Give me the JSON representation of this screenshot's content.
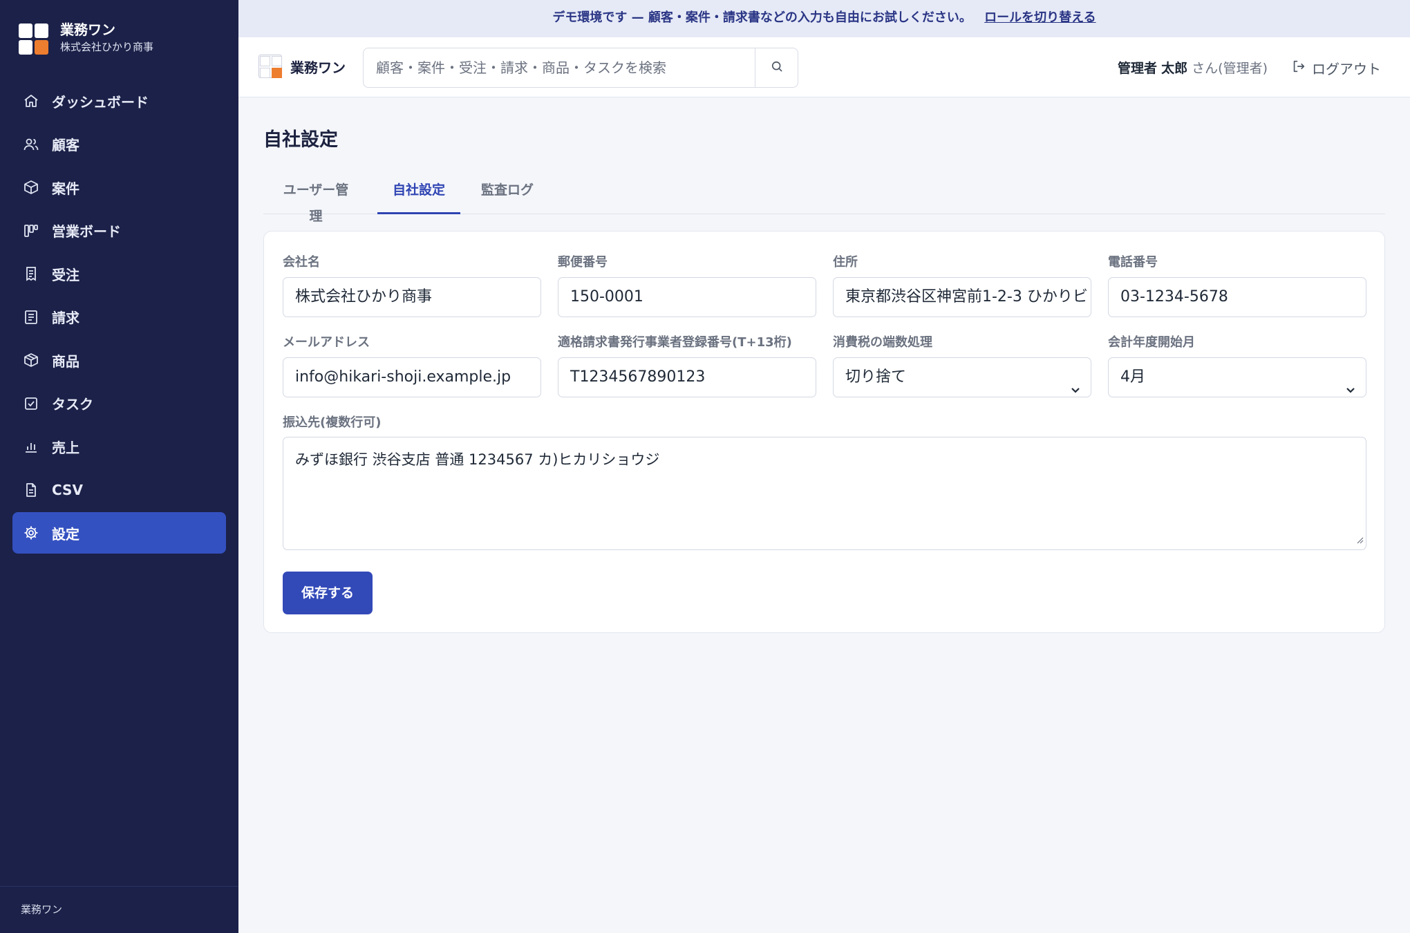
{
  "app": {
    "name": "業務ワン",
    "company": "株式会社ひかり商事",
    "footer": "業務ワン"
  },
  "banner": {
    "text": "デモ環境です — 顧客・案件・請求書などの入力も自由にお試しください。",
    "link": "ロールを切り替える"
  },
  "sidebar": {
    "items": [
      {
        "label": "ダッシュボード",
        "icon": "home-icon"
      },
      {
        "label": "顧客",
        "icon": "users-icon"
      },
      {
        "label": "案件",
        "icon": "box-icon"
      },
      {
        "label": "営業ボード",
        "icon": "kanban-icon"
      },
      {
        "label": "受注",
        "icon": "receipt-icon"
      },
      {
        "label": "請求",
        "icon": "document-icon"
      },
      {
        "label": "商品",
        "icon": "package-icon"
      },
      {
        "label": "タスク",
        "icon": "checkbox-icon"
      },
      {
        "label": "売上",
        "icon": "bar-chart-icon"
      },
      {
        "label": "CSV",
        "icon": "file-icon"
      },
      {
        "label": "設定",
        "icon": "gear-icon",
        "active": true
      }
    ]
  },
  "topbar": {
    "brand": "業務ワン",
    "search_placeholder": "顧客・案件・受注・請求・商品・タスクを検索",
    "user_role": "管理者",
    "user_name": "太郎",
    "user_suffix": "さん(管理者)",
    "logout": "ログアウト"
  },
  "page": {
    "title": "自社設定",
    "tabs": [
      "ユーザー管理",
      "自社設定",
      "監査ログ"
    ],
    "active_tab": 1
  },
  "form": {
    "company_name": {
      "label": "会社名",
      "value": "株式会社ひかり商事"
    },
    "postal_code": {
      "label": "郵便番号",
      "value": "150-0001"
    },
    "address": {
      "label": "住所",
      "value": "東京都渋谷区神宮前1-2-3 ひかりビ"
    },
    "phone": {
      "label": "電話番号",
      "value": "03-1234-5678"
    },
    "email": {
      "label": "メールアドレス",
      "value": "info@hikari-shoji.example.jp"
    },
    "invoice_number": {
      "label": "適格請求書発行事業者登録番号(T+13桁)",
      "value": "T1234567890123"
    },
    "tax_rounding": {
      "label": "消費税の端数処理",
      "value": "切り捨て"
    },
    "fiscal_start": {
      "label": "会計年度開始月",
      "value": "4月"
    },
    "bank": {
      "label": "振込先(複数行可)",
      "value": "みずほ銀行 渋谷支店 普通 1234567 カ)ヒカリショウジ"
    },
    "save": "保存する"
  },
  "colors": {
    "sidebar_bg": "#1b2148",
    "accent": "#3451c1",
    "logo_orange": "#ed7d2f"
  }
}
